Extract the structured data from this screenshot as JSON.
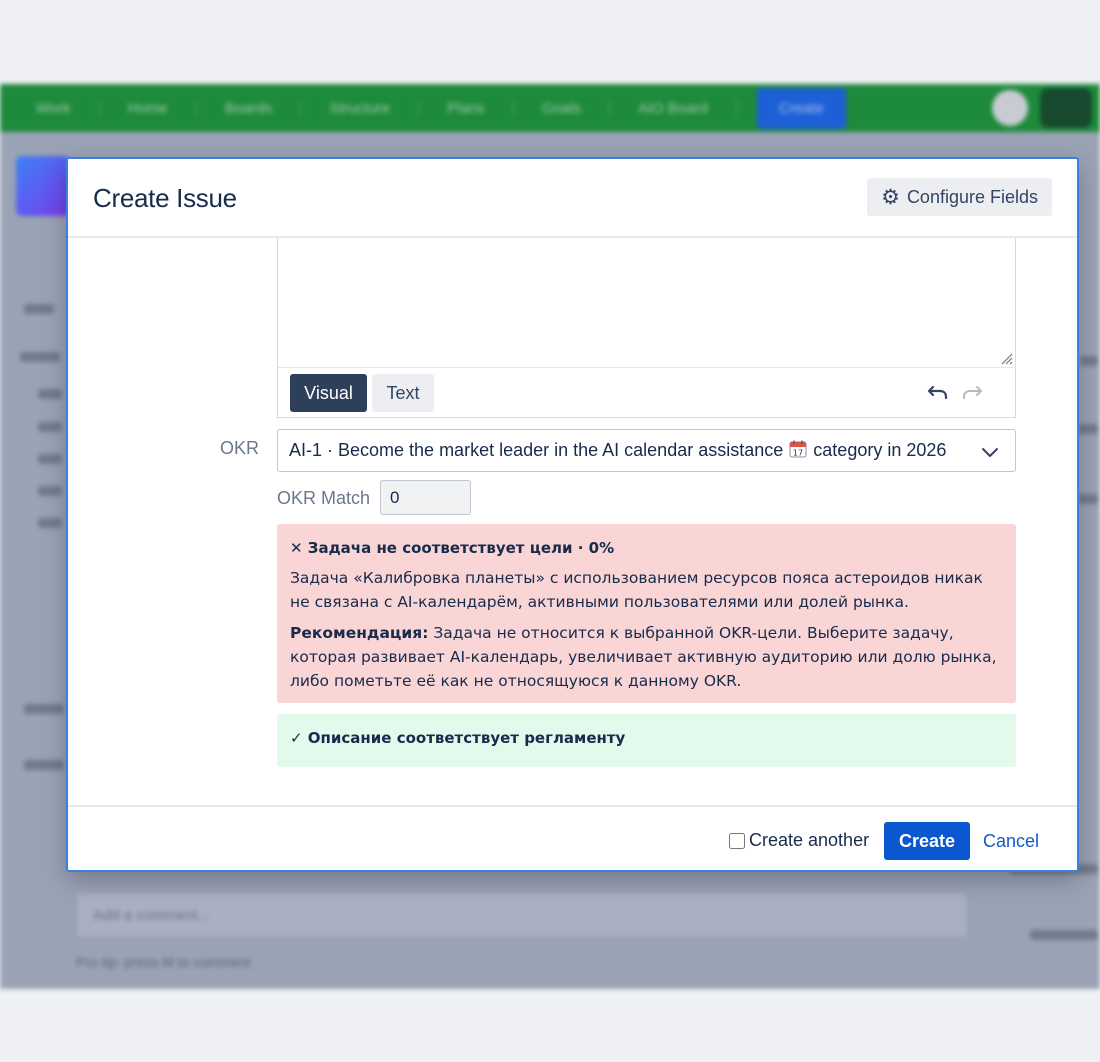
{
  "background": {
    "nav": {
      "items": [
        "Work",
        "Home",
        "Boards",
        "Structure",
        "Plans",
        "Goals",
        "AIO Board"
      ],
      "create_label": "Create"
    },
    "comment_placeholder": "Add a comment...",
    "footer_hint": "Pro tip: press M to comment"
  },
  "modal": {
    "title": "Create Issue",
    "configure_fields_label": "Configure Fields",
    "editor": {
      "tab_visual": "Visual",
      "tab_text": "Text"
    },
    "okr": {
      "label": "OKR",
      "selected_before_icon": "AI-1 · Become the market leader in the AI calendar assistance",
      "selected_after_icon": "category in 2026",
      "icon": "calendar-icon"
    },
    "okr_match": {
      "label": "OKR Match",
      "value": "0"
    },
    "error_alert": {
      "title": "✕ Задача не соответствует цели · 0%",
      "text": "Задача «Калибровка планеты» с использованием ресурсов пояса астероидов никак не связана с AI-календарём, активными пользователями или долей рынка.",
      "recommendation_label": "Рекомендация:",
      "recommendation_text": " Задача не относится к выбранной OKR-цели. Выберите задачу, которая развивает AI-календарь, увеличивает активную аудиторию или долю рынка, либо пометьте её как не относящуюся к данному OKR."
    },
    "success_alert": {
      "text": "✓ Описание соответствует регламенту"
    },
    "footer": {
      "create_another_label": "Create another",
      "create_label": "Create",
      "cancel_label": "Cancel"
    }
  },
  "colors": {
    "nav_green": "#1e8a3b",
    "primary_blue": "#0b57d0",
    "error_bg": "#f9d5d5",
    "success_bg": "#e3f9ec",
    "visual_tab": "#2e3f5c"
  }
}
